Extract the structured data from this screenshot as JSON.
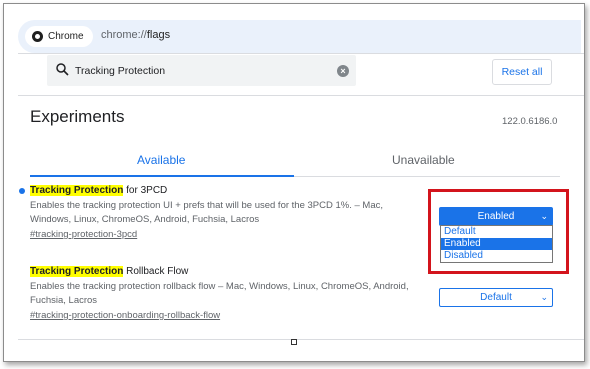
{
  "browser": {
    "chip_label": "Chrome",
    "url_scheme": "chrome://",
    "url_path": "flags"
  },
  "search": {
    "value": "Tracking Protection"
  },
  "toolbar": {
    "reset_label": "Reset all"
  },
  "page": {
    "title": "Experiments",
    "version": "122.0.6186.0"
  },
  "tabs": [
    {
      "label": "Available",
      "active": true
    },
    {
      "label": "Unavailable",
      "active": false
    }
  ],
  "experiments": [
    {
      "highlight": "Tracking Protection",
      "title_rest": " for 3PCD",
      "description": "Enables the tracking protection UI + prefs that will be used for the 3PCD 1%. – Mac, Windows, Linux, ChromeOS, Android, Fuchsia, Lacros",
      "link": "#tracking-protection-3pcd",
      "select_value": "Enabled",
      "dropdown_open": true,
      "options": [
        "Default",
        "Enabled",
        "Disabled"
      ],
      "selected_option": "Enabled"
    },
    {
      "highlight": "Tracking Protection",
      "title_rest": " Rollback Flow",
      "description": "Enables the tracking protection rollback flow – Mac, Windows, Linux, ChromeOS, Android, Fuchsia, Lacros",
      "link": "#tracking-protection-onboarding-rollback-flow",
      "select_value": "Default",
      "dropdown_open": false
    }
  ],
  "colors": {
    "accent": "#1a73e8",
    "highlight": "#ffff00",
    "annotation": "#d3141c"
  }
}
